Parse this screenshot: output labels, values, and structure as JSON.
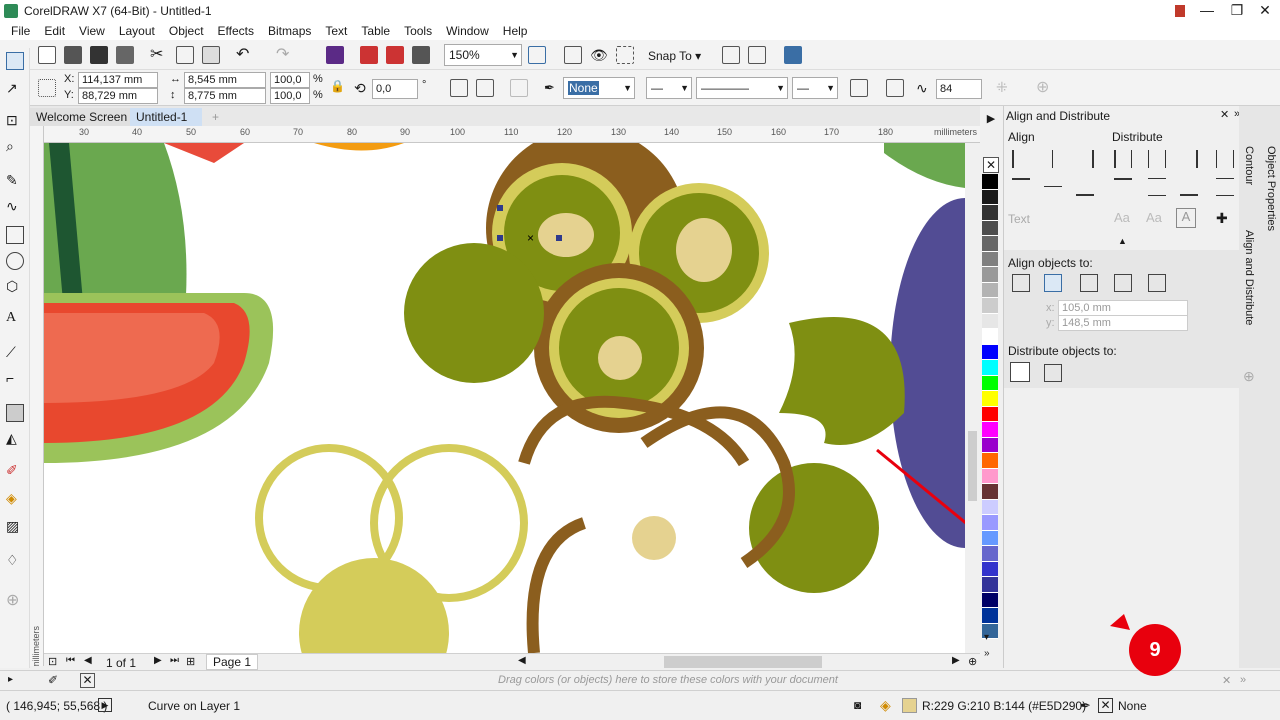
{
  "window": {
    "title": "CorelDRAW X7 (64-Bit) - Untitled-1"
  },
  "menu": [
    "File",
    "Edit",
    "View",
    "Layout",
    "Object",
    "Effects",
    "Bitmaps",
    "Text",
    "Table",
    "Tools",
    "Window",
    "Help"
  ],
  "toolbar": {
    "zoom": "150%",
    "snap_to": "Snap To"
  },
  "property_bar": {
    "x_label": "X:",
    "x": "114,137 mm",
    "y_label": "Y:",
    "y": "88,729 mm",
    "width": "8,545 mm",
    "height": "8,775 mm",
    "scale_x": "100,0",
    "scale_y": "100,0",
    "pct": "%",
    "rotation": "0,0",
    "degree": "°",
    "fill": "None",
    "spinner": "84"
  },
  "tabs": [
    "Welcome Screen",
    "Untitled-1"
  ],
  "ruler": {
    "unit": "millimeters",
    "h_ticks": [
      "30",
      "40",
      "50",
      "60",
      "70",
      "80",
      "90",
      "100",
      "110",
      "120",
      "130",
      "140",
      "150",
      "160",
      "170",
      "180"
    ]
  },
  "palette": [
    "#000000",
    "#1a1a1a",
    "#333333",
    "#4d4d4d",
    "#666666",
    "#808080",
    "#999999",
    "#b3b3b3",
    "#cccccc",
    "#e6e6e6",
    "#ffffff",
    "#0000ff",
    "#00ffff",
    "#00ff00",
    "#ffff00",
    "#ff0000",
    "#ff00ff",
    "#9900cc",
    "#ff6600",
    "#ff99cc",
    "#663333",
    "#ccccff",
    "#9999ff",
    "#6699ff",
    "#6666cc",
    "#3333cc",
    "#333399",
    "#000066",
    "#003399",
    "#336699"
  ],
  "docker": {
    "title": "Align and Distribute",
    "align": "Align",
    "distribute": "Distribute",
    "text": "Text",
    "align_to": "Align objects to:",
    "x_label": "x:",
    "x": "105,0 mm",
    "y_label": "y:",
    "y": "148,5 mm",
    "distribute_to": "Distribute objects to:",
    "side_tabs": [
      "Object Properties",
      "Contour",
      "Align and Distribute"
    ]
  },
  "page_nav": {
    "count": "1 of 1",
    "page": "Page 1"
  },
  "color_hint": "Drag colors (or objects) here to store these colors with your document",
  "status": {
    "coords": "( 146,945; 55,568 )",
    "object": "Curve on Layer 1",
    "fill_desc": "R:229 G:210 B:144 (#E5D290)",
    "outline": "None"
  },
  "annotation": {
    "badge": "9",
    "color": "#e8000d"
  }
}
